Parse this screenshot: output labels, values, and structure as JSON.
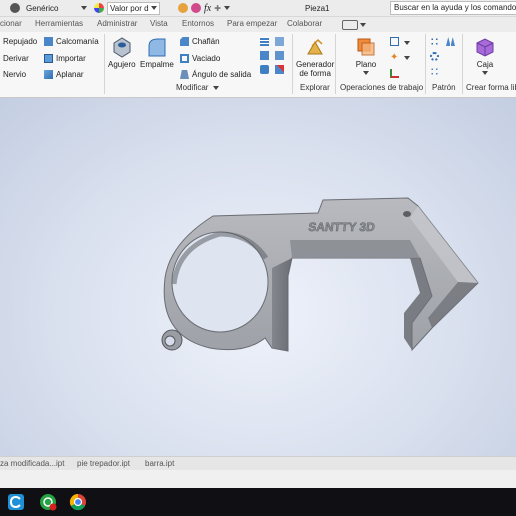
{
  "quick_access": {
    "material": "Genérico",
    "appearance": "Valor por d",
    "fx_label": "fx",
    "document_title": "Pieza1",
    "search_placeholder": "Buscar en la ayuda y los comandos"
  },
  "tabs": [
    "cionar",
    "Herramientas",
    "Administrar",
    "Vista",
    "Entornos",
    "Para empezar",
    "Colaborar"
  ],
  "ribbon": {
    "create_small": [
      "Repujado",
      "Derivar",
      "Nervio"
    ],
    "create_small2": [
      "Calcomanía",
      "Importar",
      "Aplanar"
    ],
    "modify_big": [
      "Agujero",
      "Empalme"
    ],
    "modify_small": [
      "Chaflán",
      "Vaciado",
      "Ángulo de salida"
    ],
    "modify_panel": "Modificar",
    "explore_button_line1": "Generador",
    "explore_button_line2": "de forma",
    "explore_panel": "Explorar",
    "plane_button": "Plano",
    "work_features_panel": "Operaciones de trabajo",
    "pattern_panel": "Patrón",
    "box_button": "Caja",
    "freeform_panel": "Crear forma libre"
  },
  "model": {
    "engraved_text": "SANTTY 3D"
  },
  "document_tabs": [
    "za modificada...ipt",
    "pie trepador.ipt",
    "barra.ipt"
  ],
  "colors": {
    "ribbon_bg": "#f7f7f7",
    "viewport_center": "#eef2fa",
    "viewport_edge": "#c4cee2",
    "model_gray": "#a9abb0",
    "taskbar": "#101014"
  }
}
